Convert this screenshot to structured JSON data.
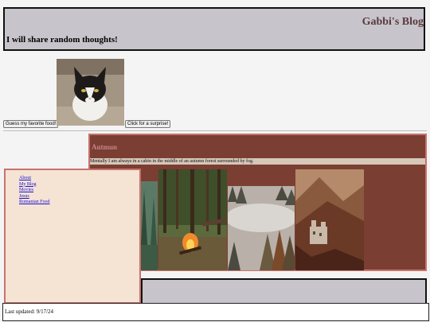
{
  "header": {
    "blog_title": "Gabbi's Blog",
    "tagline": "I will share random thoughts!"
  },
  "buttons": {
    "food": "Guess my favorite food!",
    "surprise": "Click for a surprise!"
  },
  "autumn": {
    "title": "Autmun",
    "description": "Mentally I am always in a cabin in the middle of an autumn forest surrounded by fog."
  },
  "nav": {
    "items": [
      {
        "label": "About"
      },
      {
        "label": "My Blog"
      },
      {
        "label": "Movies"
      },
      {
        "label": "Jesus"
      },
      {
        "label": "Romanian Food"
      }
    ]
  },
  "footer": {
    "text": "Last updated: 9/17/24"
  },
  "images": {
    "cat": "cat-photo",
    "forest": "forest-photo",
    "campfire": "campfire-photo",
    "fog": "foggy-forest-photo",
    "castle": "castle-photo"
  }
}
